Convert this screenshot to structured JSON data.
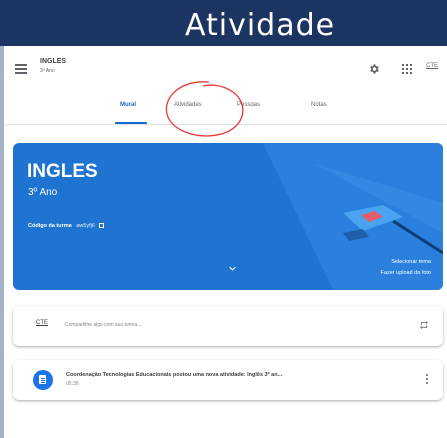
{
  "overlay": {
    "title": "Atividade",
    "annotation_color": "#e53935"
  },
  "header": {
    "class_name": "INGLES",
    "class_sub": "3º Ano",
    "account_label": "CTE",
    "icons": [
      "menu-icon",
      "gear-icon",
      "apps-icon"
    ]
  },
  "tabs": [
    {
      "label": "Mural",
      "active": true
    },
    {
      "label": "Atividades",
      "active": false
    },
    {
      "label": "Pessoas",
      "active": false
    },
    {
      "label": "Notas",
      "active": false
    }
  ],
  "banner": {
    "class_name": "INGLES",
    "class_sub": "3º Ano",
    "code_label": "Código da turma",
    "code_value": "aw5yfj6",
    "select_theme": "Selecionar tema",
    "upload_photo": "Fazer upload da foto",
    "color": "#1e74d0"
  },
  "share": {
    "avatar_label": "CTE",
    "prompt": "Compartilhe algo com sua turma..."
  },
  "post": {
    "text": "Coordenação Tecnologias Educacionais postou uma nova atividade: Inglês 3º an...",
    "time": "05:30"
  }
}
